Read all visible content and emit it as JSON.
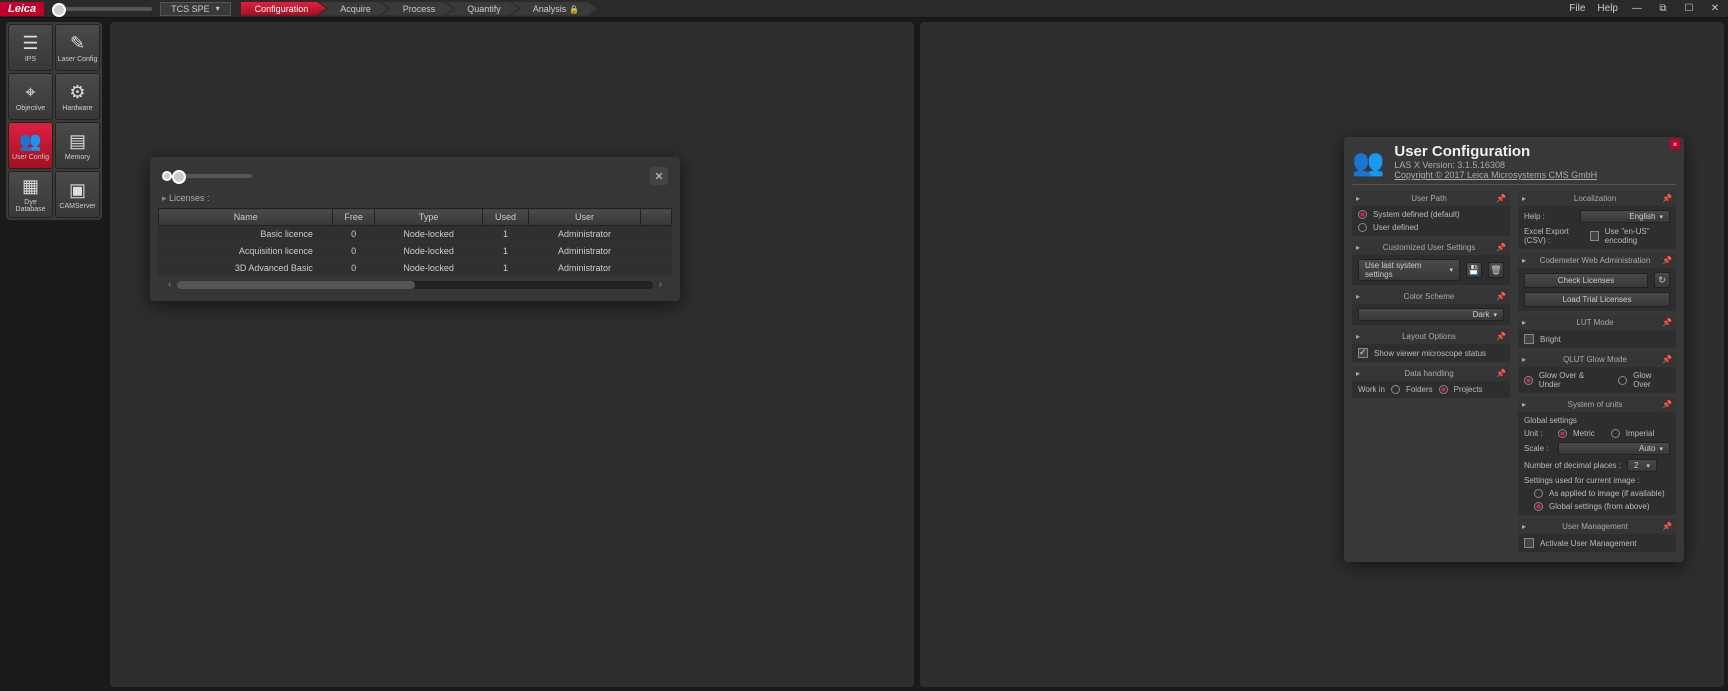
{
  "app": {
    "logo": "Leica",
    "module": "TCS SPE"
  },
  "workflow": [
    "Configuration",
    "Acquire",
    "Process",
    "Quantify",
    "Analysis"
  ],
  "menu": {
    "file": "File",
    "help": "Help"
  },
  "sidebar": [
    {
      "label": "IPS",
      "icon": "☰"
    },
    {
      "label": "Laser Config",
      "icon": "✎"
    },
    {
      "label": "Objective",
      "icon": "⌖"
    },
    {
      "label": "Hardware",
      "icon": "⚙"
    },
    {
      "label": "User Config",
      "icon": "👥"
    },
    {
      "label": "Memory",
      "icon": "▤"
    },
    {
      "label": "Dye Database",
      "icon": "▦"
    },
    {
      "label": "CAMServer",
      "icon": "▣"
    }
  ],
  "licenses": {
    "title": "Licenses :",
    "headers": [
      "Name",
      "Free",
      "Type",
      "Used",
      "User"
    ],
    "rows": [
      {
        "name": "Basic licence",
        "free": "0",
        "type": "Node-locked",
        "used": "1",
        "user": "Administrator"
      },
      {
        "name": "Acquisition licence",
        "free": "0",
        "type": "Node-locked",
        "used": "1",
        "user": "Administrator"
      },
      {
        "name": "3D Advanced Basic",
        "free": "0",
        "type": "Node-locked",
        "used": "1",
        "user": "Administrator"
      }
    ]
  },
  "userConfig": {
    "title": "User Configuration",
    "version": "LAS X Version: 3.1.5.16308",
    "copyright": "Copyright © 2017 Leica Microsystems CMS GmbH",
    "userPath": {
      "title": "User Path",
      "opt1": "System defined (default)",
      "opt2": "User defined"
    },
    "localization": {
      "title": "Localization",
      "helpLabel": "Help :",
      "helpValue": "English",
      "csvLabel": "Excel Export (CSV) :",
      "csvValue": "Use \"en-US\" encoding"
    },
    "custom": {
      "title": "Customized User Settings",
      "dropdown": "Use last system settings"
    },
    "codemeter": {
      "title": "Codemeter Web Administration",
      "btn1": "Check Licenses",
      "btn2": "Load Trial Licenses"
    },
    "colorScheme": {
      "title": "Color Scheme",
      "value": "Dark"
    },
    "lutMode": {
      "title": "LUT Mode",
      "value": "Bright"
    },
    "glow": {
      "title": "QLUT Glow Mode",
      "opt1": "Glow Over & Under",
      "opt2": "Glow Over"
    },
    "layout": {
      "title": "Layout Options",
      "opt": "Show viewer microscope status"
    },
    "units": {
      "title": "System of units",
      "global": "Global settings",
      "unitLabel": "Unit :",
      "metric": "Metric",
      "imperial": "Imperial",
      "scaleLabel": "Scale :",
      "scaleValue": "Auto",
      "decLabel": "Number of decimal places :",
      "decValue": "2",
      "imgSettings": "Settings used for current image :",
      "imgOpt1": "As applied to image (if available)",
      "imgOpt2": "Global settings (from above)"
    },
    "dataHandling": {
      "title": "Data handling",
      "workIn": "Work in",
      "folders": "Folders",
      "projects": "Projects"
    },
    "userMgmt": {
      "title": "User Management",
      "activate": "Activate User Management"
    }
  }
}
